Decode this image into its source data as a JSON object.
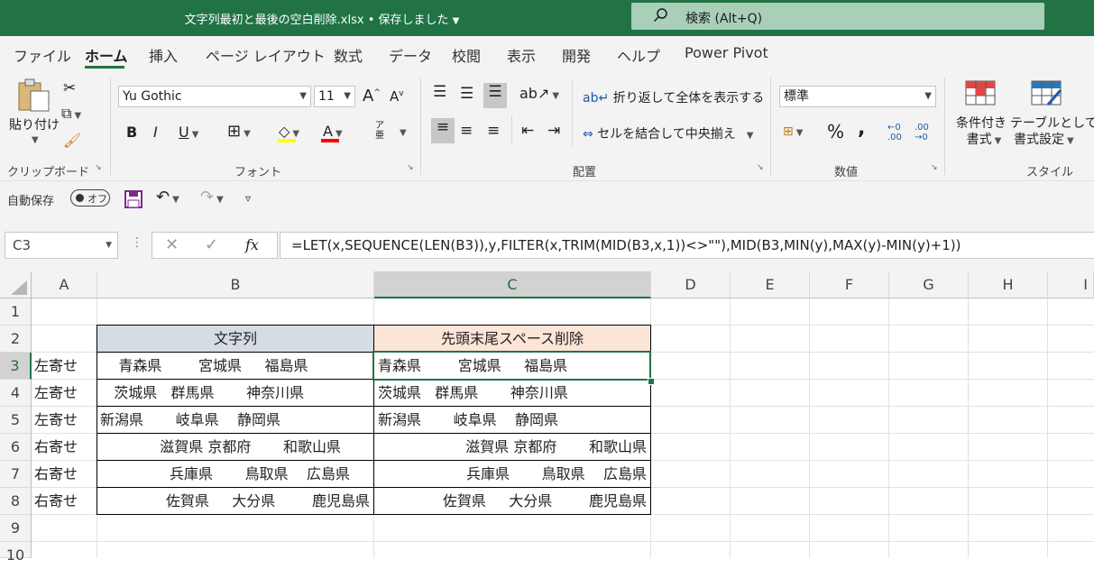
{
  "title": "文字列最初と最後の空白削除.xlsx • 保存しました",
  "search": {
    "text": "検索 (Alt+Q)"
  },
  "tabs": [
    "ファイル",
    "ホーム",
    "挿入",
    "ページ レイアウト",
    "数式",
    "データ",
    "校閲",
    "表示",
    "開発",
    "ヘルプ",
    "Power Pivot"
  ],
  "ribbon": {
    "clipboard": {
      "label": "クリップボード",
      "paste": "貼り付け"
    },
    "font": {
      "label": "フォント",
      "name": "Yu Gothic",
      "size": "11"
    },
    "alignment": {
      "label": "配置",
      "wrap": "折り返して全体を表示する",
      "merge": "セルを結合して中央揃え"
    },
    "number": {
      "label": "数値",
      "format": "標準"
    },
    "styles": {
      "label": "スタイル",
      "conditional_line1": "条件付き",
      "conditional_line2": "書式",
      "table_line1": "テーブルとして",
      "table_line2": "書式設定"
    }
  },
  "qat": {
    "autosave": "自動保存",
    "autosave_state": "オフ"
  },
  "formula_bar": {
    "namebox": "C3",
    "formula": "=LET(x,SEQUENCE(LEN(B3)),y,FILTER(x,TRIM(MID(B3,x,1))<>\"\"),MID(B3,MIN(y),MAX(y)-MIN(y)+1))"
  },
  "columns": [
    "A",
    "B",
    "C",
    "D",
    "E",
    "F",
    "G",
    "H",
    "I"
  ],
  "rows": [
    "1",
    "2",
    "3",
    "4",
    "5",
    "6",
    "7",
    "8",
    "9",
    "10"
  ],
  "table": {
    "header_b": "文字列",
    "header_c": "先頭末尾スペース削除",
    "rows": [
      {
        "a": "左寄せ",
        "b": "    青森県        宮城県     福島県",
        "c": "青森県        宮城県     福島県"
      },
      {
        "a": "左寄せ",
        "b": "   茨城県   群馬県       神奈川県",
        "c": "茨城県   群馬県       神奈川県"
      },
      {
        "a": "左寄せ",
        "b": "新潟県       岐阜県    静岡県",
        "c": "新潟県       岐阜県    静岡県"
      },
      {
        "a": "右寄せ",
        "b": "滋賀県 京都府       和歌山県",
        "c": "滋賀県 京都府       和歌山県"
      },
      {
        "a": "右寄せ",
        "b": "兵庫県       鳥取県    広島県",
        "c": "兵庫県       鳥取県    広島県"
      },
      {
        "a": "右寄せ",
        "b": "佐賀県     大分県        鹿児島県",
        "c": "佐賀県     大分県        鹿児島県"
      }
    ]
  },
  "colors": {
    "excel_green": "#217346",
    "header_b_fill": "#d6dce4",
    "header_c_fill": "#fce4d6"
  }
}
